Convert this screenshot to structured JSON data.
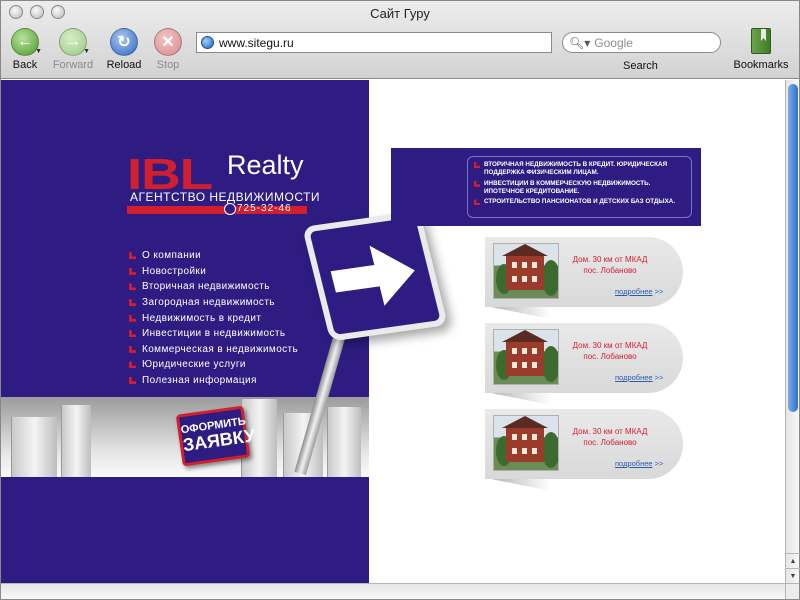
{
  "window": {
    "title": "Сайт Гуру"
  },
  "toolbar": {
    "back_label": "Back",
    "forward_label": "Forward",
    "reload_label": "Reload",
    "stop_label": "Stop",
    "search_label": "Search",
    "bookmarks_label": "Bookmarks"
  },
  "address": {
    "url": "www.sitegu.ru"
  },
  "search": {
    "placeholder": "Google"
  },
  "icons": {
    "back": "back-arrow-icon",
    "forward": "forward-arrow-icon",
    "reload": "reload-icon",
    "stop": "stop-x-icon",
    "bookmarks": "bookmarks-book-icon",
    "site": "globe-icon",
    "search": "magnifier-icon"
  },
  "colors": {
    "brand_blue": "#2e1c82",
    "brand_red": "#d21f2e",
    "link_blue": "#2a5db0"
  },
  "site": {
    "logo": {
      "mark": "IBL",
      "word": "Realty",
      "subtitle": "АГЕНТСТВО НЕДВИЖИМОСТИ",
      "phone": "725-32-46"
    },
    "menu": [
      "О компании",
      "Новостройки",
      "Вторичная недвижимость",
      "Загородная недвижимость",
      "Недвижимость в кредит",
      "Инвестиции в недвижимость",
      "Коммерческая в недвижимость",
      "Юридические услуги",
      "Полезная информация"
    ],
    "order_button": {
      "line1": "ОФОРМИТЬ",
      "line2": "ЗАЯВКУ"
    },
    "banner": [
      "Вторичная недвижимость в кредит. Юридическая поддержка физическим лицам.",
      "Инвестиции в коммерческую недвижимость. Ипотечное кредитование.",
      "Строительство пансионатов и детских баз отдыха."
    ],
    "cards": [
      {
        "line1": "Дом. 30 км от МКАД",
        "line2": "пос. Лобаново",
        "more": "подробнее",
        "more_arrow": ">>"
      },
      {
        "line1": "Дом. 30 км от МКАД",
        "line2": "пос. Лобаново",
        "more": "подробнее",
        "more_arrow": ">>"
      },
      {
        "line1": "Дом. 30 км от МКАД",
        "line2": "пос. Лобаново",
        "more": "подробнее",
        "more_arrow": ">>"
      }
    ]
  }
}
